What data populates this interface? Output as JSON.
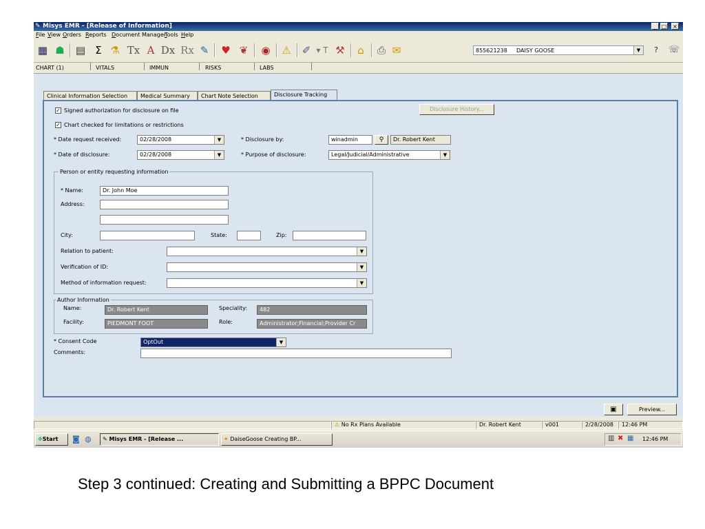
{
  "window": {
    "title": "Misys EMR - [Release of Information]",
    "min": "_",
    "max": "□",
    "close": "×"
  },
  "menu": [
    "File",
    "View",
    "Orders",
    "Reports",
    "Document Manager",
    "Tools",
    "Help"
  ],
  "toolbar": {
    "patient_id": "855621238",
    "patient_name": "DAISY GOOSE",
    "help": "?"
  },
  "chart_tabs": [
    "CHART (1)",
    "VITALS",
    "IMMUN",
    "RISKS",
    "LABS"
  ],
  "sub_tabs": [
    "Clinical Information Selection",
    "Medical Summary",
    "Chart Note Selection",
    "Disclosure Tracking"
  ],
  "form": {
    "signed_auth": "Signed authorization for disclosure on file",
    "chart_checked": "Chart checked for limitations or restrictions",
    "check_mark": "✓",
    "disclosure_history": "Disclosure History...",
    "date_request_label": "* Date request received:",
    "date_request_value": "02/28/2008",
    "date_disclosure_label": "* Date of disclosure:",
    "date_disclosure_value": "02/28/2008",
    "disclosure_by_label": "* Disclosure by:",
    "disclosure_by_value": "winadmin",
    "disclosure_by_name": "Dr. Robert Kent",
    "purpose_label": "* Purpose of disclosure:",
    "purpose_value": "Legal/Judicial/Administrative",
    "person_group": "Person or entity requesting information",
    "name_label": "* Name:",
    "name_value": "Dr. John Moe",
    "address_label": "Address:",
    "city_label": "City:",
    "state_label": "State:",
    "zip_label": "Zip:",
    "relation_label": "Relation to patient:",
    "verification_label": "Verification of ID:",
    "method_label": "Method of information request:",
    "author_group": "Author Information",
    "author_name_label": "Name:",
    "author_name_value": "Dr. Robert Kent",
    "speciality_label": "Speciality:",
    "speciality_value": "482",
    "facility_label": "Facility:",
    "facility_value": "PIEDMONT FOOT",
    "role_label": "Role:",
    "role_value": "Administrator;Financial;Provider Cr",
    "consent_label": "* Consent Code",
    "consent_value": "OptOut",
    "comments_label": "Comments:",
    "dropdown_arrow": "▼"
  },
  "buttons": {
    "preview": "Preview..."
  },
  "status": {
    "rx": "No Rx Plans Available",
    "user": "Dr. Robert Kent",
    "code": "v001",
    "date": "2/28/2008",
    "time": "12:46 PM"
  },
  "taskbar": {
    "start": "Start",
    "task1": "Misys EMR - [Release ...",
    "task2": "DaiseGoose Creating BP...",
    "clock": "12:46 PM"
  },
  "caption": "Step 3 continued: Creating and Submitting a BPPC Document"
}
